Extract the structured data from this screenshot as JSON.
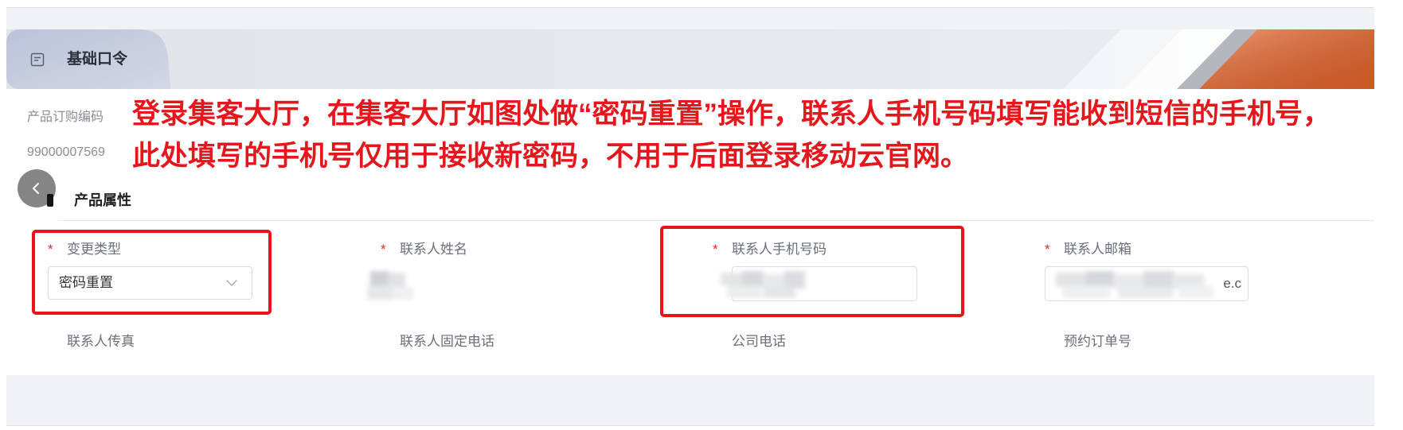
{
  "colors": {
    "accent": "#e9652b",
    "annotation": "#e5171d",
    "required": "#e8262b"
  },
  "icons": {
    "tab_icon": "document-icon",
    "collapse_icon": "chevron-left-icon",
    "select_icon": "chevron-down-icon"
  },
  "header": {
    "tab_label": "基础口令"
  },
  "order": {
    "code_label": "产品订购编码",
    "code_value": "99000007569"
  },
  "annotation": {
    "line1": "登录集客大厅，在集客大厅如图处做“密码重置”操作，联系人手机号码填写能收到短信的手机号，",
    "line2": "此处填写的手机号仅用于接收新密码，不用于后面登录移动云官网。"
  },
  "section": {
    "title": "产品属性"
  },
  "form": {
    "required_mark": "*",
    "row1": [
      {
        "label": "变更类型",
        "value": "密码重置"
      },
      {
        "label": "联系人姓名"
      },
      {
        "label": "联系人手机号码"
      },
      {
        "label": "联系人邮箱",
        "value_visible": "e.c"
      }
    ],
    "row2": [
      {
        "label": "联系人传真"
      },
      {
        "label": "联系人固定电话"
      },
      {
        "label": "公司电话"
      },
      {
        "label": "预约订单号"
      }
    ]
  }
}
